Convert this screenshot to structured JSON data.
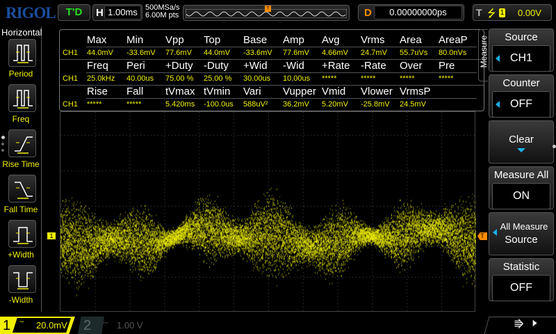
{
  "header": {
    "logo": "RIGOL",
    "run_state": "T'D",
    "timebase_label": "H",
    "timebase": "1.00ms",
    "sample_rate": "500MSa/s",
    "memory_depth": "6.00M pts",
    "delay_label": "D",
    "delay": "0.00000000ps",
    "trigger_label": "T",
    "trigger_source": "1",
    "trigger_level": "0.00V"
  },
  "left_menu": {
    "title": "Horizontal",
    "items": [
      {
        "label": "Period",
        "icon": "period-icon"
      },
      {
        "label": "Freq",
        "icon": "freq-icon"
      },
      {
        "label": "Rise Time",
        "icon": "rise-time-icon"
      },
      {
        "label": "Fall Time",
        "icon": "fall-time-icon"
      },
      {
        "label": "+Width",
        "icon": "positive-width-icon"
      },
      {
        "label": "-Width",
        "icon": "negative-width-icon"
      }
    ]
  },
  "measurements": {
    "channel": "CH1",
    "rows": [
      {
        "headers": [
          "Max",
          "Min",
          "Vpp",
          "Top",
          "Base",
          "Amp",
          "Avg",
          "Vrms",
          "Area",
          "AreaP"
        ],
        "values": [
          "44.0mV",
          "-33.6mV",
          "77.6mV",
          "44.0mV",
          "-33.6mV",
          "77.6mV",
          "4.66mV",
          "24.7mV",
          "55.7uVs",
          "80.0nVs"
        ]
      },
      {
        "headers": [
          "Freq",
          "Peri",
          "+Duty",
          "-Duty",
          "+Wid",
          "-Wid",
          "+Rate",
          "-Rate",
          "Over",
          "Pre"
        ],
        "values": [
          "25.0kHz",
          "40.00us",
          "75.00 %",
          "25.00 %",
          "30.00us",
          "10.00us",
          "*****",
          "*****",
          "*****",
          "*****"
        ]
      },
      {
        "headers": [
          "Rise",
          "Fall",
          "tVmax",
          "tVmin",
          "Vari",
          "Vupper",
          "Vmid",
          "Vlower",
          "VrmsP",
          ""
        ],
        "values": [
          "*****",
          "*****",
          "5.420ms",
          "-100.0us",
          "588uV²",
          "36.2mV",
          "5.20mV",
          "-25.8mV",
          "24.5mV",
          ""
        ]
      }
    ]
  },
  "right_menu": {
    "tab": "Measure",
    "items": [
      {
        "title": "Source",
        "value": "CH1"
      },
      {
        "title": "Counter",
        "value": "OFF"
      },
      {
        "title": "Clear"
      },
      {
        "title": "Measure All",
        "value": "ON"
      },
      {
        "title": "All Measure",
        "value": "Source"
      },
      {
        "title": "Statistic",
        "value": "OFF"
      }
    ]
  },
  "markers": {
    "ch1": "1",
    "trigger": "T"
  },
  "footer": {
    "ch1_num": "1",
    "ch1_coupling": "~",
    "ch1_scale": "20.0mV",
    "ch2_num": "2",
    "ch2_coupling": "⎓",
    "ch2_scale": "1.00 V"
  },
  "colors": {
    "ch1": "#f0f000",
    "trigger": "#ff8c00",
    "accent": "#1ab0e8",
    "logo": "#1a4fa0"
  }
}
